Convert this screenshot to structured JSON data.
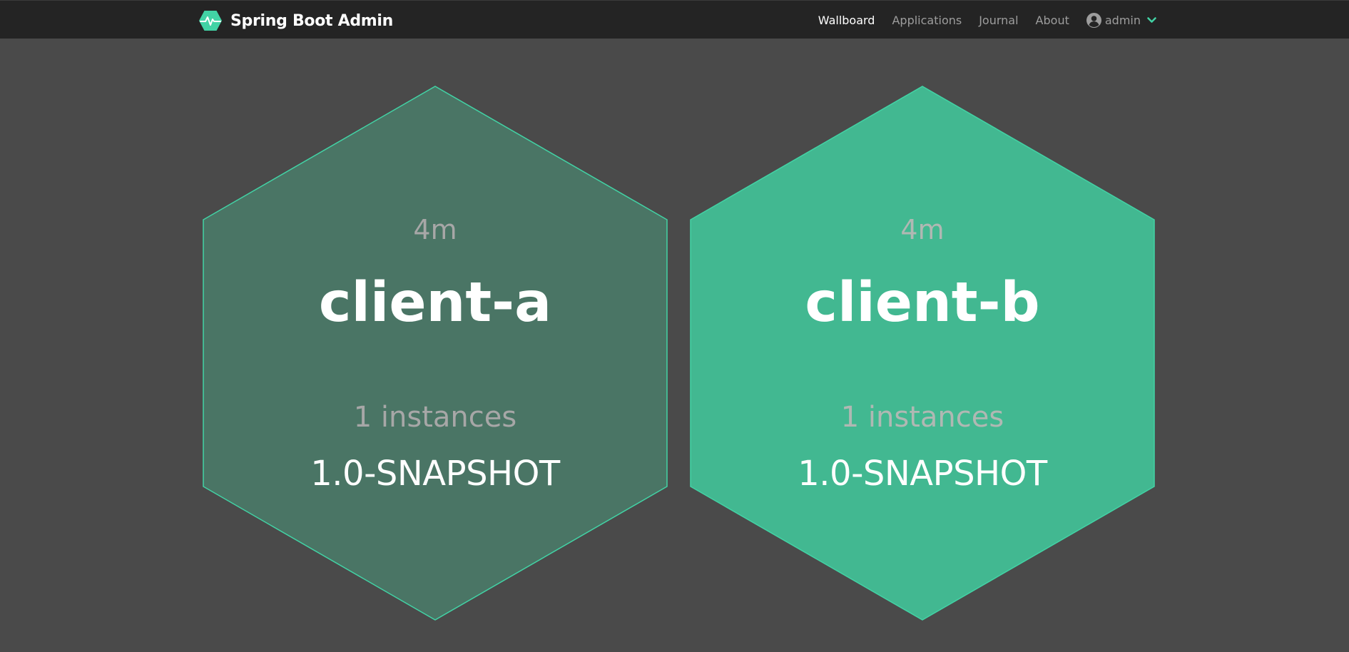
{
  "app": {
    "title": "Spring Boot Admin"
  },
  "nav": {
    "items": [
      {
        "label": "Wallboard",
        "active": true
      },
      {
        "label": "Applications",
        "active": false
      },
      {
        "label": "Journal",
        "active": false
      },
      {
        "label": "About",
        "active": false
      }
    ],
    "user": {
      "name": "admin",
      "icon": "user-circle-icon",
      "dropdown_icon": "chevron-down-icon"
    }
  },
  "colors": {
    "navbar_bg": "#242424",
    "page_bg": "#4a4a4a",
    "brand_accent": "#42d3a5",
    "status_up": "#42b891",
    "hex_dim_fill": "#4a7565",
    "hex_border": "#42d3a5"
  },
  "applications": [
    {
      "since": "4m",
      "name": "client-a",
      "instances": "1 instances",
      "version": "1.0-SNAPSHOT"
    },
    {
      "since": "4m",
      "name": "client-b",
      "instances": "1 instances",
      "version": "1.0-SNAPSHOT"
    }
  ]
}
